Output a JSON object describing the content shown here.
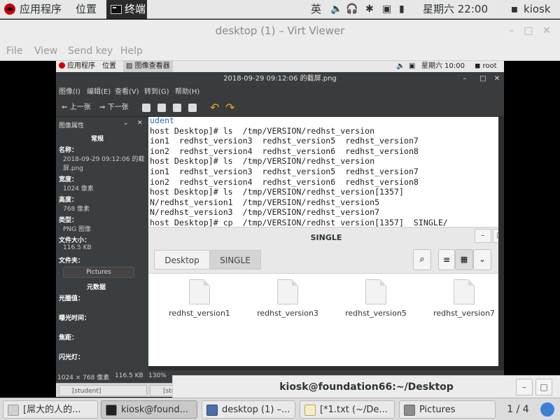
{
  "host_top_panel": {
    "applications": "应用程序",
    "places": "位置",
    "active_app": "终端",
    "input_method": "英",
    "clock": "星期六 22:00",
    "user": "kiosk"
  },
  "virt_viewer": {
    "title": "desktop (1) – Virt Viewer",
    "menu": [
      "File",
      "View",
      "Send key",
      "Help"
    ]
  },
  "guest": {
    "top_panel": {
      "applications": "应用程序",
      "places": "位置",
      "active_app": "图像查看器",
      "clock": "星期六 10:00",
      "user": "root"
    },
    "image_viewer": {
      "title": "2018-09-29 09:12:06 的截屏.png",
      "menu": [
        "图像(I)",
        "编辑(E)",
        "查看(V)",
        "转到(G)",
        "帮助(H)"
      ],
      "toolbar": {
        "prev": "上一张",
        "next": "下一张"
      },
      "sidebar": {
        "header": "图像属性",
        "section_general": "常规",
        "name_label": "名称：",
        "name_value_1": "2018-09-29 09:12:06 的截",
        "name_value_2": "屏.png",
        "width_label": "宽度：",
        "width_value": "1024 像素",
        "height_label": "高度：",
        "height_value": "768 像素",
        "type_label": "类型：",
        "type_value": "PNG 图像",
        "size_label": "文件大小：",
        "size_value": "116.5 KB",
        "folder_label": "文件夹：",
        "folder_button": "Pictures",
        "section_meta": "元数据",
        "aperture": "光圈值：",
        "exposure": "曝光时间：",
        "focal": "焦距：",
        "flash": "闪光灯："
      },
      "status": {
        "dimensions": "1024 × 768 像素",
        "filesize": "116.5 KB",
        "zoom": "130%"
      }
    },
    "terminal_lines": [
      "udent",
      "host Desktop]# ls  /tmp/VERSION/redhst_version",
      "ion1  redhst_version3  redhst_version5  redhst_version7",
      "ion2  redhst_version4  redhst_version6  redhst_version8",
      "host Desktop]# ls  /tmp/VERSION/redhst_version",
      "ion1  redhst_version3  redhst_version5  redhst_version7",
      "ion2  redhst_version4  redhst_version6  redhst_version8",
      "host Desktop]# ls  /tmp/VERSION/redhst_version[1357]",
      "N/redhst_version1  /tmp/VERSION/redhst_version5",
      "N/redhst_version3  /tmp/VERSION/redhst_version7",
      "host Desktop]# cp  /tmp/VERSION/redhst_version[1357]  SINGLE/"
    ],
    "file_manager": {
      "title": "SINGLE",
      "breadcrumbs": [
        "Desktop",
        "SINGLE"
      ],
      "files": [
        "redhst_version1",
        "redhst_version3",
        "redhst_version5",
        "redhst_version7"
      ]
    },
    "taskbar": [
      "[student]",
      "[stude"
    ]
  },
  "overlay_window": {
    "title": "kiosk@foundation66:~/Desktop"
  },
  "host_taskbar": {
    "items": [
      "[屌大的人的...",
      "kiosk@found...",
      "desktop (1) –...",
      "[*1.txt (~/De...",
      "Pictures"
    ],
    "pager": "1 / 4"
  }
}
